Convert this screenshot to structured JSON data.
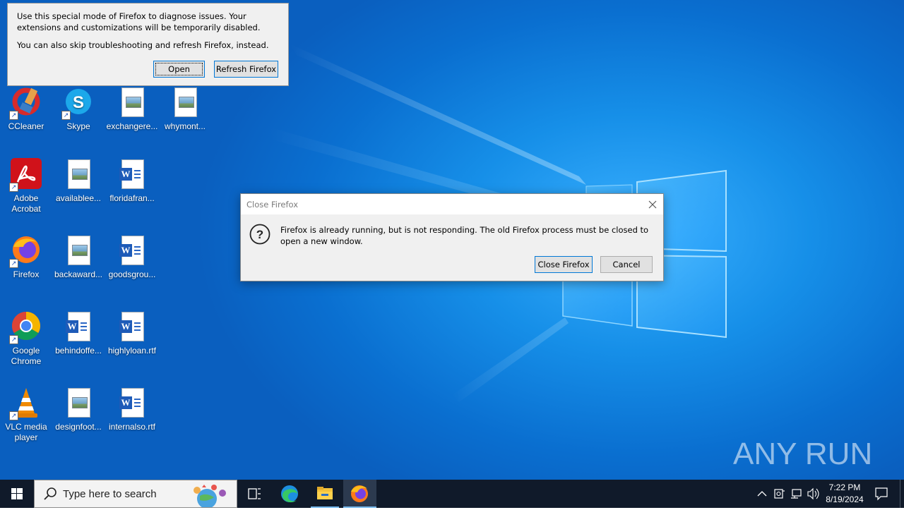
{
  "desktop": {
    "icons": [
      {
        "label": "CCleaner",
        "type": "app"
      },
      {
        "label": "Skype",
        "type": "app"
      },
      {
        "label": "exchangere...",
        "type": "image"
      },
      {
        "label": "whymont...",
        "type": "image"
      },
      {
        "label": "Adobe Acrobat",
        "type": "app"
      },
      {
        "label": "availablee...",
        "type": "image"
      },
      {
        "label": "floridafran...",
        "type": "word"
      },
      {
        "label": "Firefox",
        "type": "app"
      },
      {
        "label": "backaward...",
        "type": "image"
      },
      {
        "label": "goodsgrou...",
        "type": "word"
      },
      {
        "label": "Google Chrome",
        "type": "app"
      },
      {
        "label": "behindoffe...",
        "type": "word"
      },
      {
        "label": "highlyloan.rtf",
        "type": "word"
      },
      {
        "label": "VLC media player",
        "type": "app"
      },
      {
        "label": "designfoot...",
        "type": "image"
      },
      {
        "label": "internalso.rtf",
        "type": "word"
      }
    ],
    "watermark": "ANY RUN"
  },
  "troubleshoot_popup": {
    "line1": "Use this special mode of Firefox to diagnose issues. Your extensions and customizations will be temporarily disabled.",
    "line2": "You can also skip troubleshooting and refresh Firefox, instead.",
    "open_label": "Open",
    "refresh_label": "Refresh Firefox"
  },
  "close_dialog": {
    "title": "Close Firefox",
    "message": "Firefox is already running, but is not responding. The old Firefox process must be closed to open a new window.",
    "close_label": "Close Firefox",
    "cancel_label": "Cancel",
    "icon": "question-icon"
  },
  "taskbar": {
    "search_placeholder": "Type here to search",
    "time": "7:22 PM",
    "date": "8/19/2024",
    "pinned": [
      "task-view-icon",
      "edge-icon",
      "file-explorer-icon",
      "firefox-icon"
    ],
    "accent": "#0078d7"
  }
}
